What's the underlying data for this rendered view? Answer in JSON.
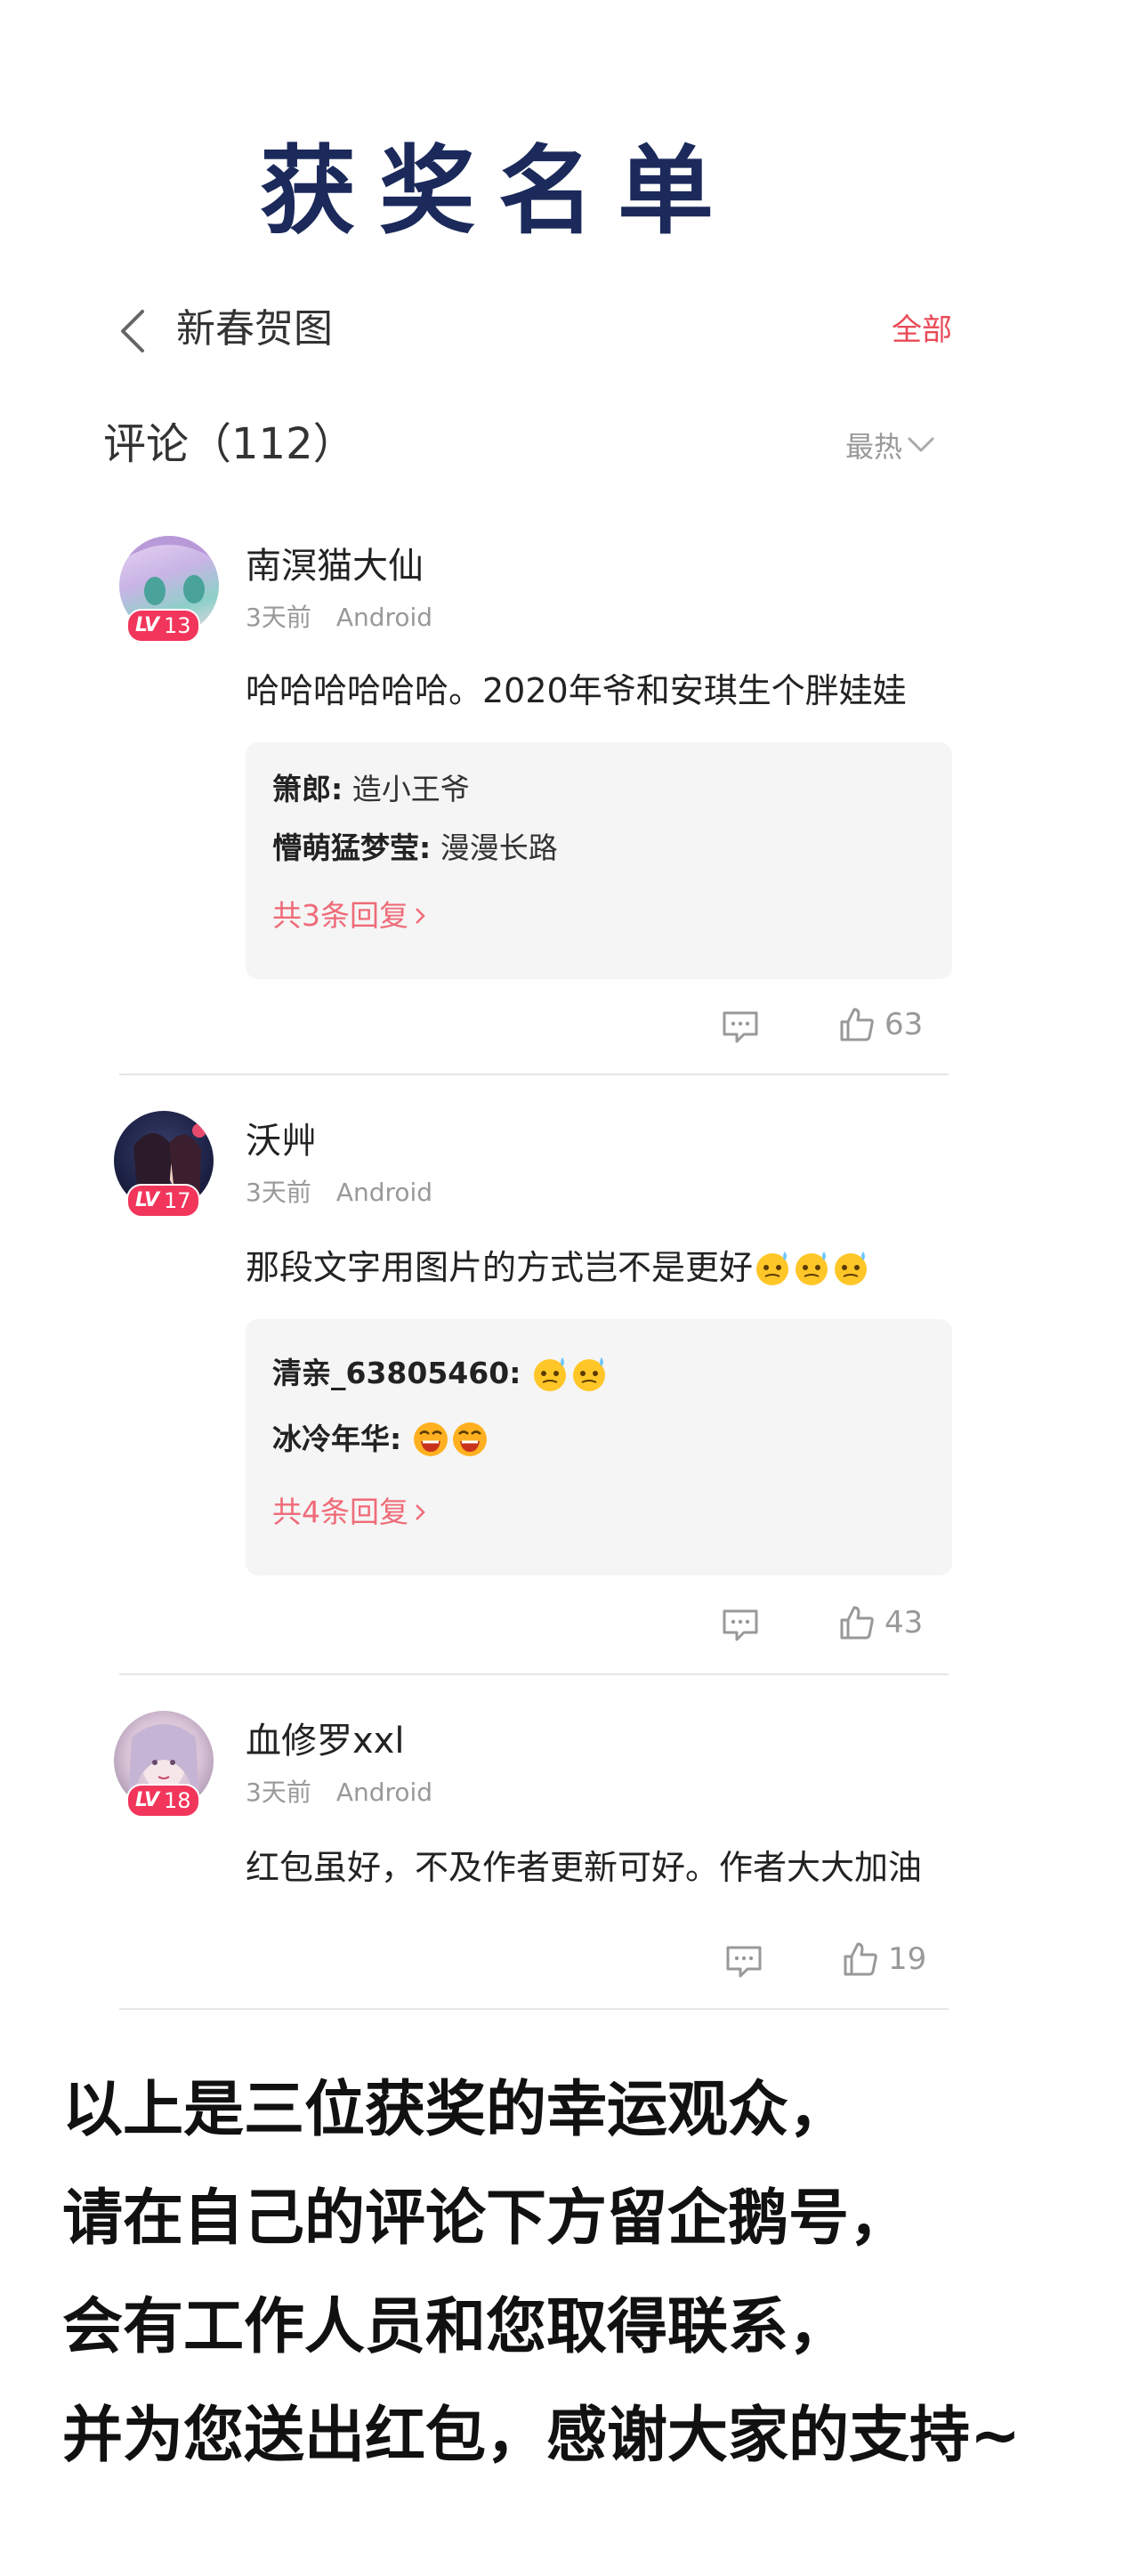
{
  "banner": {
    "title": "获奖名单"
  },
  "nav": {
    "title": "新春贺图",
    "all_label": "全部"
  },
  "comments_header": {
    "label": "评论（112）",
    "sort_label": "最热"
  },
  "comments": [
    {
      "username": "南溟猫大仙",
      "level_text": "LV",
      "level": "13",
      "time": "3天前",
      "platform": "Android",
      "text": "哈哈哈哈哈哈。2020年爷和安琪生个胖娃娃",
      "replies": [
        {
          "name": "箫郎:",
          "text": "造小王爷"
        },
        {
          "name": "懵萌猛梦莹:",
          "text": "漫漫长路"
        }
      ],
      "more_replies": "共3条回复",
      "likes": "63"
    },
    {
      "username": "沃艸",
      "level_text": "LV",
      "level": "17",
      "time": "3天前",
      "platform": "Android",
      "text": "那段文字用图片的方式岂不是更好",
      "replies": [
        {
          "name": "清亲_63805460:",
          "text": ""
        },
        {
          "name": "冰冷年华:",
          "text": ""
        }
      ],
      "more_replies": "共4条回复",
      "likes": "43"
    },
    {
      "username": "血修罗xxl",
      "level_text": "LV",
      "level": "18",
      "time": "3天前",
      "platform": "Android",
      "text": "红包虽好，不及作者更新可好。作者大大加油",
      "likes": "19"
    }
  ],
  "notice": {
    "line1": "以上是三位获奖的幸运观众，",
    "line2": "请在自己的评论下方留企鹅号，",
    "line3": "会有工作人员和您取得联系，",
    "line4": "并为您送出红包，感谢大家的支持~"
  },
  "colors": {
    "accent": "#e94a57",
    "title": "#1b2a5a",
    "badge": "#f2355b",
    "more_link": "#ef6b78"
  },
  "icons": [
    "back-chevron-icon",
    "chevron-down-icon",
    "comment-icon",
    "thumbs-up-icon",
    "emoji-sweat-icon",
    "emoji-laugh-cry-icon"
  ]
}
